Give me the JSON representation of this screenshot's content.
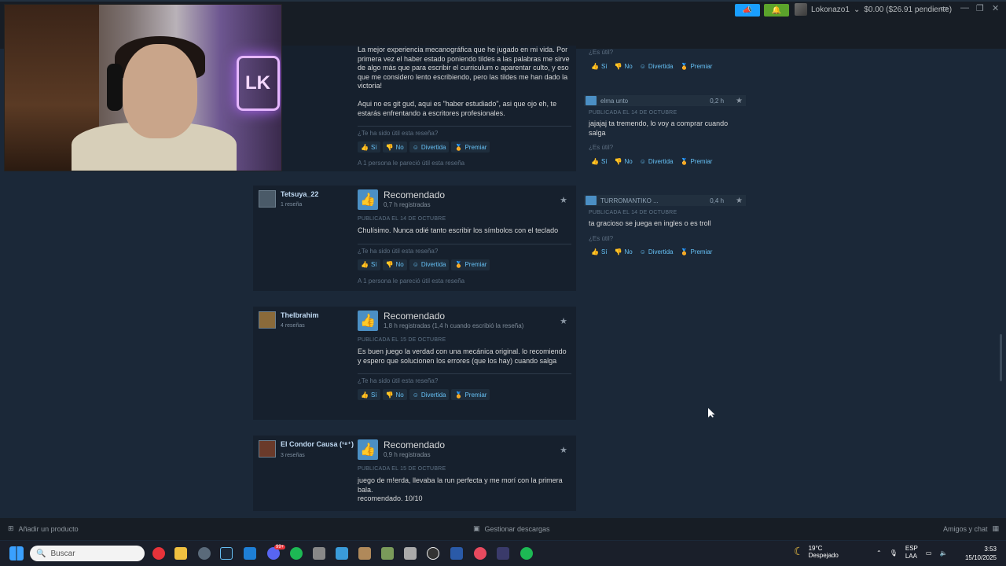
{
  "topbar": {
    "username": "Lokonazo1",
    "balance": "$0.00 ($26.91 pendiente)"
  },
  "webcam": {
    "neon_text": "LK"
  },
  "reviews": [
    {
      "text": "La mejor experiencia mecanográfica que he jugado en mi vida. Por primera vez el haber estado poniendo tildes a las palabras me sirve de algo más que para escribir el curriculum o aparentar culto, y eso que me considero lento escribiendo, pero las tildes me han dado la victoria!\n\nAqui no es git gud, aqui es \"haber estudiado\", asi que ojo eh, te estarás enfrentando a escritores profesionales.",
      "question": "¿Te ha sido útil esta reseña?",
      "helpful": "A 1 persona le pareció útil esta reseña"
    },
    {
      "author": "Tetsuya_22",
      "count": "1 reseña",
      "verdict": "Recomendado",
      "hours": "0,7 h registradas",
      "date": "PUBLICADA EL 14 DE OCTUBRE",
      "text": "Chulísimo. Nunca odié tanto escribir los símbolos con el teclado",
      "question": "¿Te ha sido útil esta reseña?",
      "helpful": "A 1 persona le pareció útil esta reseña"
    },
    {
      "author": "TheIbrahim",
      "count": "4 reseñas",
      "verdict": "Recomendado",
      "hours": "1,8 h registradas (1,4 h cuando escribió la reseña)",
      "date": "PUBLICADA EL 15 DE OCTUBRE",
      "text": "Es buen juego la verdad con una mecánica original. lo recomiendo y espero que solucionen los errores (que los hay) cuando salga",
      "question": "¿Te ha sido útil esta reseña?"
    },
    {
      "author": "El Condor Causa (¹⁸⁺)",
      "count": "3 reseñas",
      "verdict": "Recomendado",
      "hours": "0,9 h registradas",
      "date": "PUBLICADA EL 15 DE OCTUBRE",
      "text": "juego de m!erda, llevaba la run perfecta y me morí con la primera bala.\nrecomendado. 10/10"
    }
  ],
  "vote_labels": {
    "yes": "Sí",
    "no": "No",
    "funny": "Divertida",
    "award": "Premiar"
  },
  "comments": [
    {
      "question": "¿Es útil?"
    },
    {
      "author": "elma unto",
      "hours": "0,2 h",
      "date": "PUBLICADA EL 14 DE OCTUBRE",
      "text": "jajajaj ta tremendo, lo voy a comprar cuando salga",
      "question": "¿Es útil?"
    },
    {
      "author": "TURROMANTIKO ...",
      "hours": "0,4 h",
      "date": "PUBLICADA EL 14 DE OCTUBRE",
      "text": "ta gracioso se juega en ingles o es troll",
      "question": "¿Es útil?"
    }
  ],
  "footer": {
    "add_product": "Añadir un producto",
    "downloads": "Gestionar descargas",
    "friends": "Amigos y chat"
  },
  "taskbar": {
    "search_placeholder": "Buscar",
    "temp": "19°C",
    "weather": "Despejado",
    "lang1": "ESP",
    "lang2": "LAA",
    "time": "3:53",
    "date": "15/10/2025",
    "notif_badge": "99+"
  }
}
